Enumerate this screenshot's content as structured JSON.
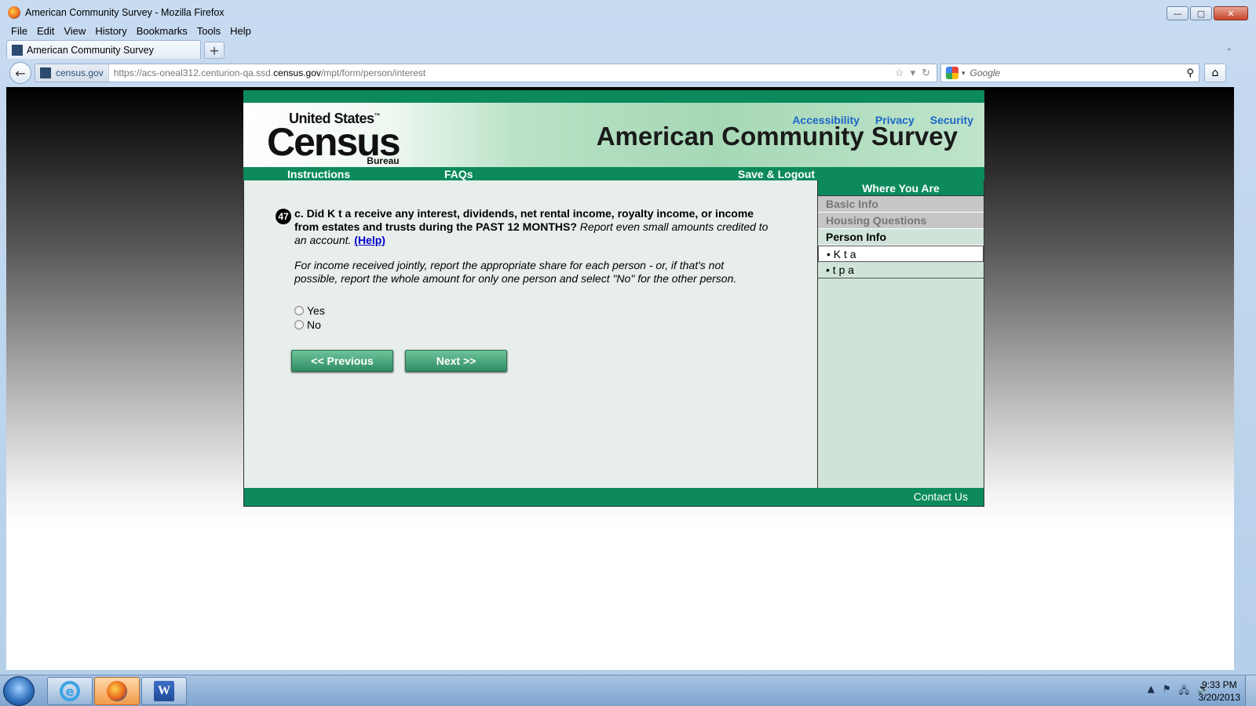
{
  "window": {
    "title": "American Community Survey - Mozilla Firefox",
    "buttons": {
      "minimize": "—",
      "maximize": "▢",
      "close": "✕"
    }
  },
  "menu": [
    "File",
    "Edit",
    "View",
    "History",
    "Bookmarks",
    "Tools",
    "Help"
  ],
  "tab": {
    "label": "American Community Survey",
    "new_tab": "+"
  },
  "tablist_arrow": "⌄",
  "address": {
    "identity": "census.gov",
    "url_prefix": "https://acs-oneal312.centurion-qa.ssd.",
    "url_domain": "census.gov",
    "url_suffix": "/mpt/form/person/interest"
  },
  "search": {
    "placeholder": "Google"
  },
  "page": {
    "logo": {
      "line1": "United States",
      "tm": "™",
      "line2": "Census",
      "line3": "Bureau"
    },
    "banner_title": "American Community Survey",
    "nav": {
      "instructions": "Instructions",
      "faqs": "FAQs",
      "save_logout": "Save & Logout"
    },
    "question": {
      "number": "47",
      "text_bold": "c. Did K t a receive any interest, dividends, net rental income, royalty income, or income from estates and trusts during the PAST 12 MONTHS?",
      "text_italic": " Report even small amounts credited to an account. ",
      "help": "(Help)",
      "note": "For income received jointly, report the appropriate share for each person - or, if that's not possible, report the whole amount for only one person and select \"No\" for the other person."
    },
    "options": [
      "Yes",
      "No"
    ],
    "buttons": {
      "previous": "<<   Previous",
      "next": "Next   >>"
    },
    "sidebar": {
      "header": "Where You Are",
      "items": [
        {
          "label": "Basic Info",
          "state": "disabled"
        },
        {
          "label": "Housing Questions",
          "state": "disabled"
        },
        {
          "label": "Person Info",
          "state": "active"
        },
        {
          "label": "• K t a",
          "state": "current"
        },
        {
          "label": "• t p a",
          "state": "person"
        }
      ]
    },
    "footer": {
      "contact": "Contact Us",
      "links": [
        "Accessibility",
        "Privacy",
        "Security"
      ]
    }
  },
  "taskbar": {
    "apps": [
      "internet-explorer",
      "firefox",
      "word"
    ],
    "word_letter": "W",
    "ie_letter": "e",
    "tray_icons": [
      "▲",
      "⚑",
      "🖧",
      "🔊"
    ],
    "time": "9:33 PM",
    "date": "3/20/2013"
  },
  "colors": {
    "green": "#0c8a5c",
    "link_blue": "#1a66c8"
  }
}
